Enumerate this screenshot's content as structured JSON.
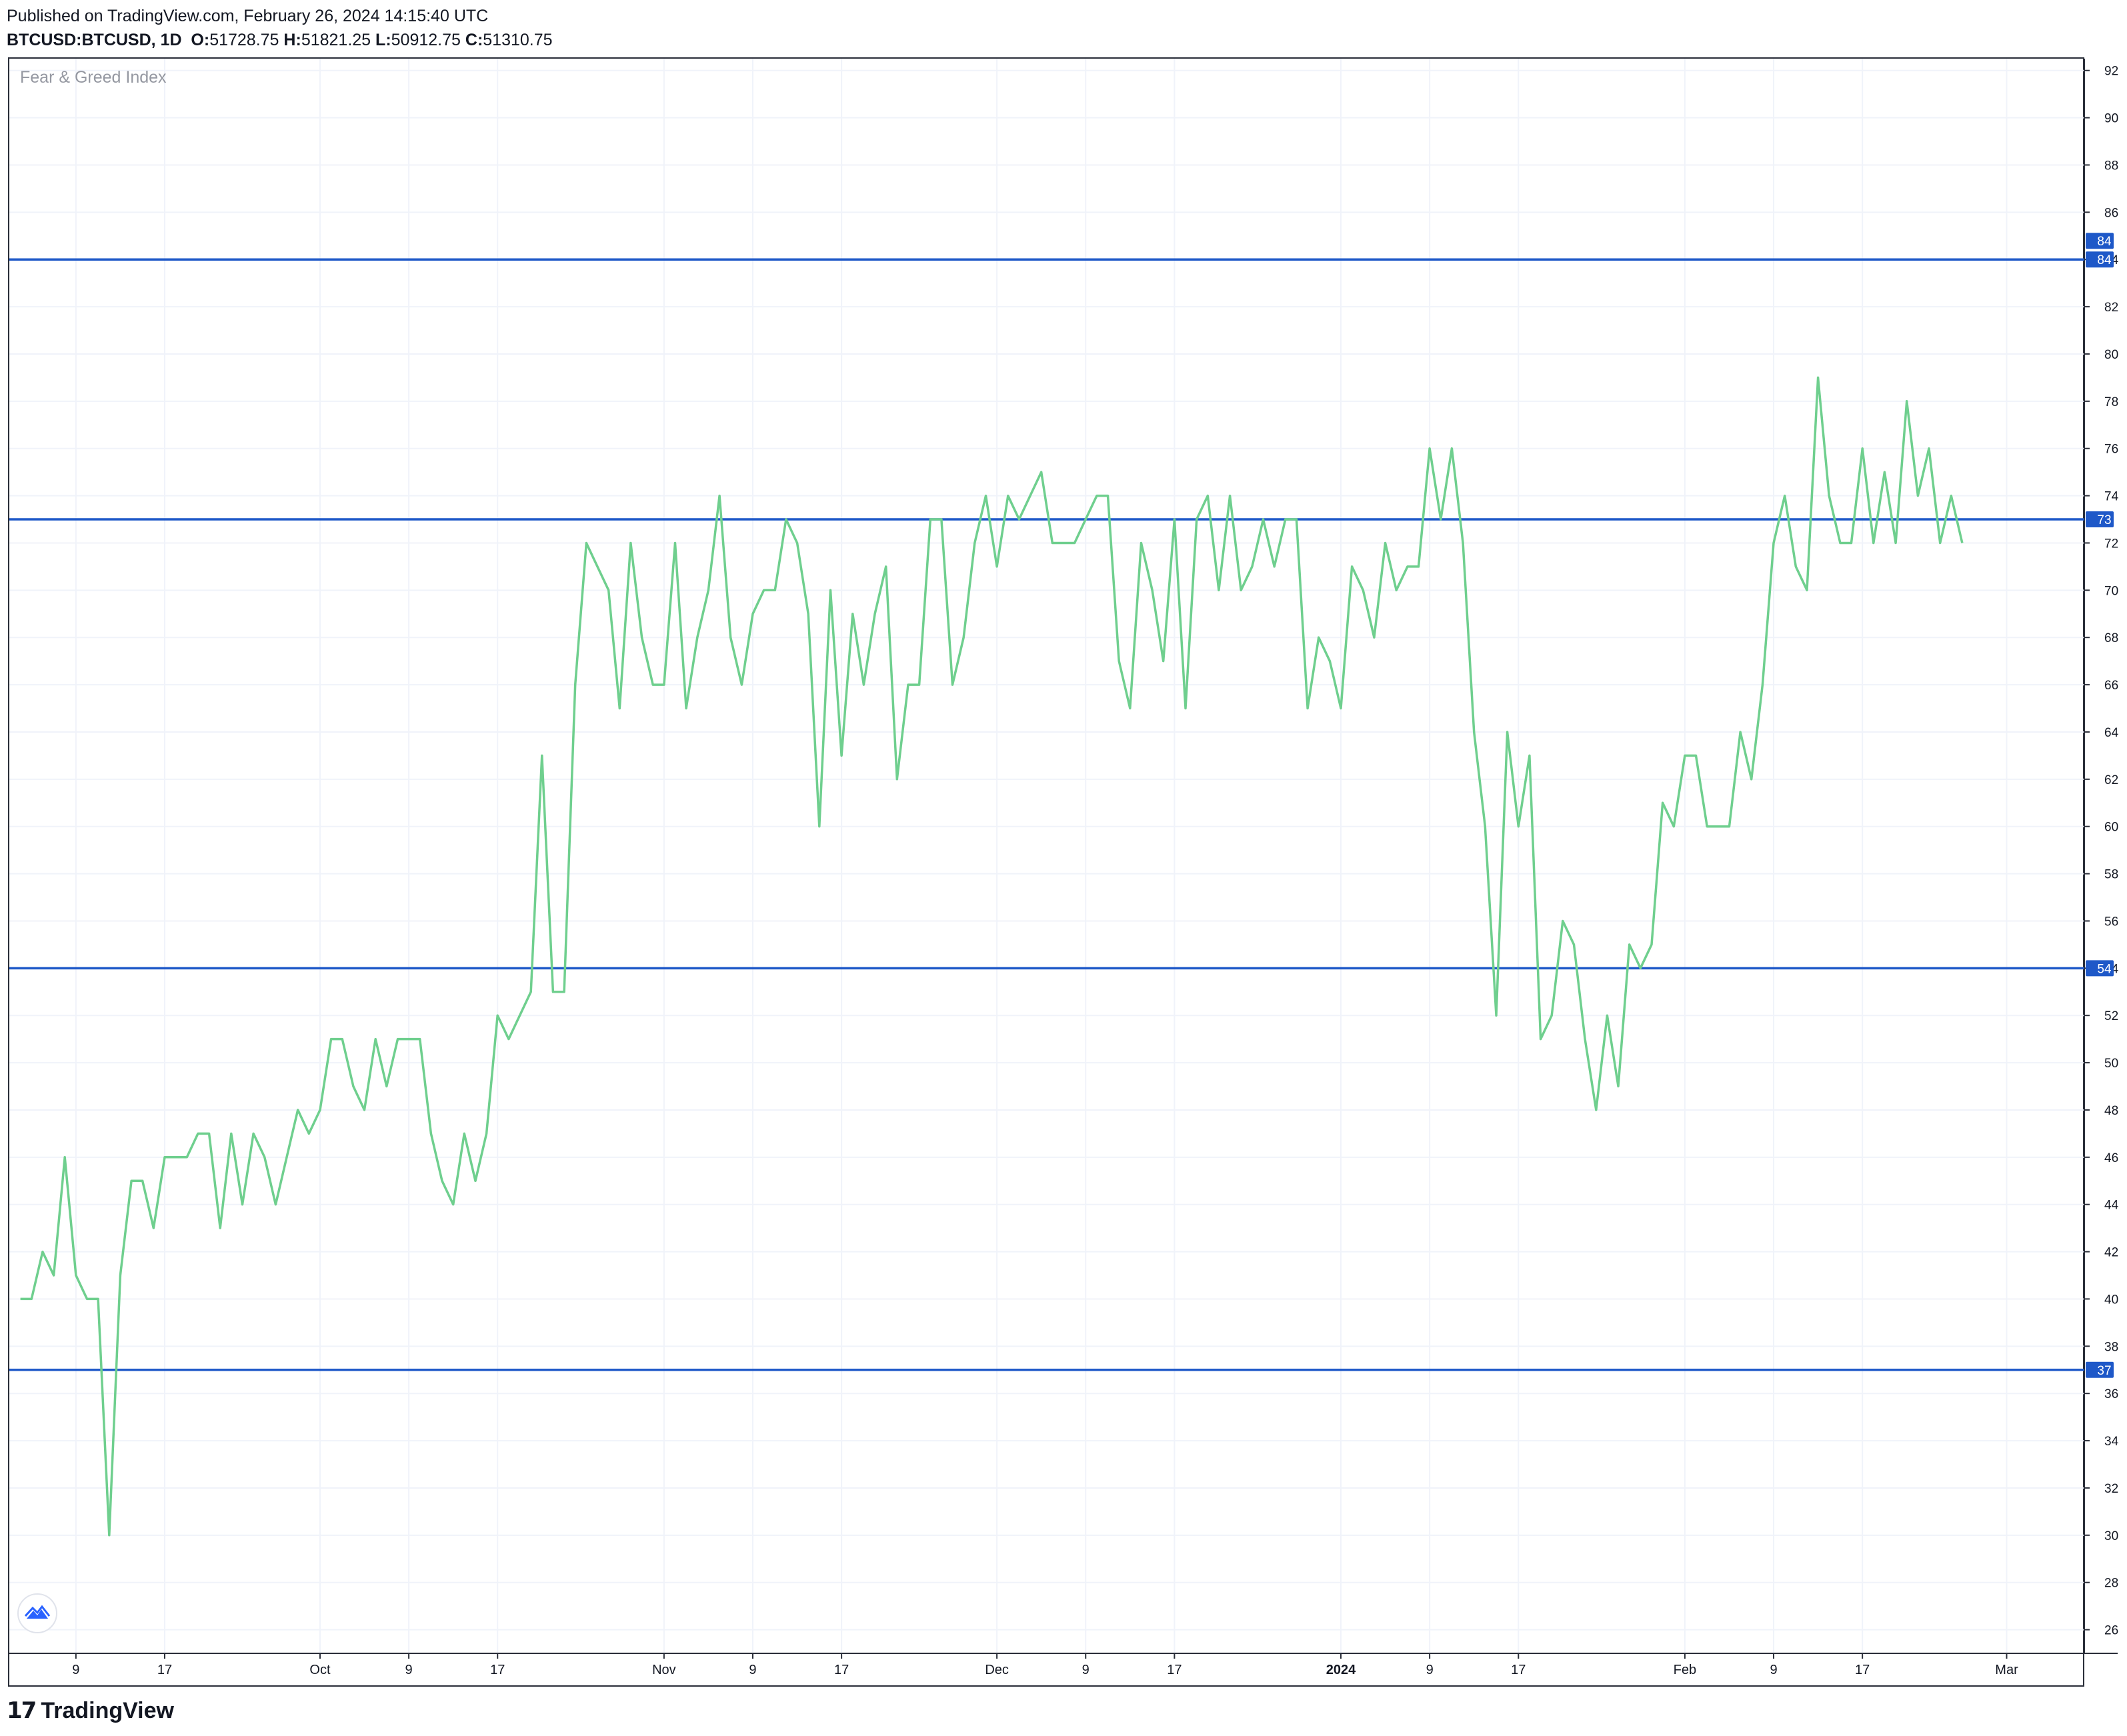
{
  "header": {
    "published": "Published on TradingView.com, February 26, 2024 14:15:40 UTC",
    "symbol": "BTCUSD:BTCUSD, 1D",
    "o_label": "O:",
    "o_value": "51728.75",
    "h_label": "H:",
    "h_value": "51821.25",
    "l_label": "L:",
    "l_value": "50912.75",
    "c_label": "C:",
    "c_value": "51310.75"
  },
  "indicator_title": "Fear & Greed Index",
  "footer": {
    "brand": "TradingView",
    "logo_icon": "tradingview-logo-icon"
  },
  "colors": {
    "line": "#6fcf8e",
    "hline": "#1e58c8",
    "grid": "#f0f3fa",
    "axis_text": "#131722"
  },
  "chart_data": {
    "type": "line",
    "title": "",
    "xlabel": "",
    "ylabel": "",
    "ylim": [
      25,
      92.5
    ],
    "y_ticks": [
      26,
      28,
      30,
      32,
      34,
      36,
      38,
      40,
      42,
      44,
      46,
      48,
      50,
      52,
      54,
      56,
      58,
      60,
      62,
      64,
      66,
      68,
      70,
      72,
      74,
      76,
      78,
      80,
      82,
      84,
      86,
      88,
      90,
      92
    ],
    "x_ticks": [
      {
        "label": "9",
        "date": "2023-09-09"
      },
      {
        "label": "17",
        "date": "2023-09-17"
      },
      {
        "label": "Oct",
        "date": "2023-10-01"
      },
      {
        "label": "9",
        "date": "2023-10-09"
      },
      {
        "label": "17",
        "date": "2023-10-17"
      },
      {
        "label": "Nov",
        "date": "2023-11-01"
      },
      {
        "label": "9",
        "date": "2023-11-09"
      },
      {
        "label": "17",
        "date": "2023-11-17"
      },
      {
        "label": "Dec",
        "date": "2023-12-01"
      },
      {
        "label": "9",
        "date": "2023-12-09"
      },
      {
        "label": "17",
        "date": "2023-12-17"
      },
      {
        "label": "2024",
        "date": "2024-01-01"
      },
      {
        "label": "9",
        "date": "2024-01-09"
      },
      {
        "label": "17",
        "date": "2024-01-17"
      },
      {
        "label": "Feb",
        "date": "2024-02-01"
      },
      {
        "label": "9",
        "date": "2024-02-09"
      },
      {
        "label": "17",
        "date": "2024-02-17"
      },
      {
        "label": "Mar",
        "date": "2024-03-01"
      }
    ],
    "x_range": [
      "2023-09-03",
      "2024-03-08"
    ],
    "grid": true,
    "horizontal_lines": [
      84,
      73,
      54,
      37
    ],
    "hline_labels": [
      "84",
      "84",
      "73",
      "54",
      "37"
    ],
    "series": [
      {
        "start_date": "2023-09-04",
        "values": [
          40,
          40,
          42,
          41,
          46,
          41,
          40,
          40,
          30,
          41,
          45,
          45,
          43,
          46,
          46,
          46,
          47,
          47,
          43,
          47,
          44,
          47,
          46,
          44,
          46,
          48,
          47,
          48,
          51,
          51,
          49,
          48,
          51,
          49,
          51,
          51,
          51,
          47,
          45,
          44,
          47,
          45,
          47,
          52,
          51,
          52,
          53,
          63,
          53,
          53,
          66,
          72,
          71,
          70,
          65,
          72,
          68,
          66,
          66,
          72,
          65,
          68,
          70,
          74,
          68,
          66,
          69,
          70,
          70,
          73,
          72,
          69,
          60,
          70,
          63,
          69,
          66,
          69,
          71,
          62,
          66,
          66,
          73,
          73,
          66,
          68,
          72,
          74,
          71,
          74,
          73,
          74,
          75,
          72,
          72,
          72,
          73,
          74,
          74,
          67,
          65,
          72,
          70,
          67,
          73,
          65,
          73,
          74,
          70,
          74,
          70,
          71,
          73,
          71,
          73,
          73,
          65,
          68,
          67,
          65,
          71,
          70,
          68,
          72,
          70,
          71,
          71,
          76,
          73,
          76,
          72,
          64,
          60,
          52,
          64,
          60,
          63,
          51,
          52,
          56,
          55,
          51,
          48,
          52,
          49,
          55,
          54,
          55,
          61,
          60,
          63,
          63,
          60,
          60,
          60,
          64,
          62,
          66,
          72,
          74,
          71,
          70,
          79,
          74,
          72,
          72,
          76,
          72,
          75,
          72,
          78,
          74,
          76,
          72,
          74,
          72
        ]
      }
    ]
  }
}
